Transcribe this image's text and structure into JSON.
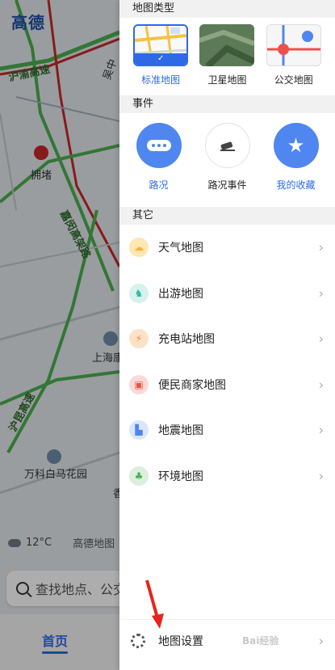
{
  "map": {
    "brand_logo": "高德",
    "labels": [
      "沪渝高速",
      "吴中",
      "拥堵",
      "嘉闵高架路",
      "上海康",
      "沪昆高速",
      "万科白马花园",
      "香"
    ],
    "weather": {
      "temperature": "12°C",
      "brand": "高德地图"
    },
    "search_placeholder": "查找地点、公交",
    "bottom_nav": {
      "home": "首页"
    }
  },
  "panel": {
    "map_type": {
      "header": "地图类型",
      "items": [
        {
          "label": "标准地图",
          "selected": true
        },
        {
          "label": "卫星地图",
          "selected": false
        },
        {
          "label": "公交地图",
          "selected": false
        }
      ]
    },
    "events": {
      "header": "事件",
      "items": [
        {
          "label": "路况",
          "icon": "traffic-dots-icon",
          "style": "blue"
        },
        {
          "label": "路况事件",
          "icon": "car-accident-icon",
          "style": "white"
        },
        {
          "label": "我的收藏",
          "icon": "star-icon",
          "style": "blue"
        }
      ]
    },
    "other": {
      "header": "其它",
      "items": [
        {
          "label": "天气地图",
          "icon": "weather-icon",
          "color": "#f5b432"
        },
        {
          "label": "出游地图",
          "icon": "horse-icon",
          "color": "#2fb7a0"
        },
        {
          "label": "充电站地图",
          "icon": "charging-icon",
          "color": "#f08a24"
        },
        {
          "label": "便民商家地图",
          "icon": "shop-icon",
          "color": "#e9524a"
        },
        {
          "label": "地震地图",
          "icon": "earthquake-icon",
          "color": "#4f86f0"
        },
        {
          "label": "环境地图",
          "icon": "tree-icon",
          "color": "#4cb050"
        }
      ]
    },
    "settings": {
      "label": "地图设置"
    }
  },
  "watermark": "Bai经验"
}
